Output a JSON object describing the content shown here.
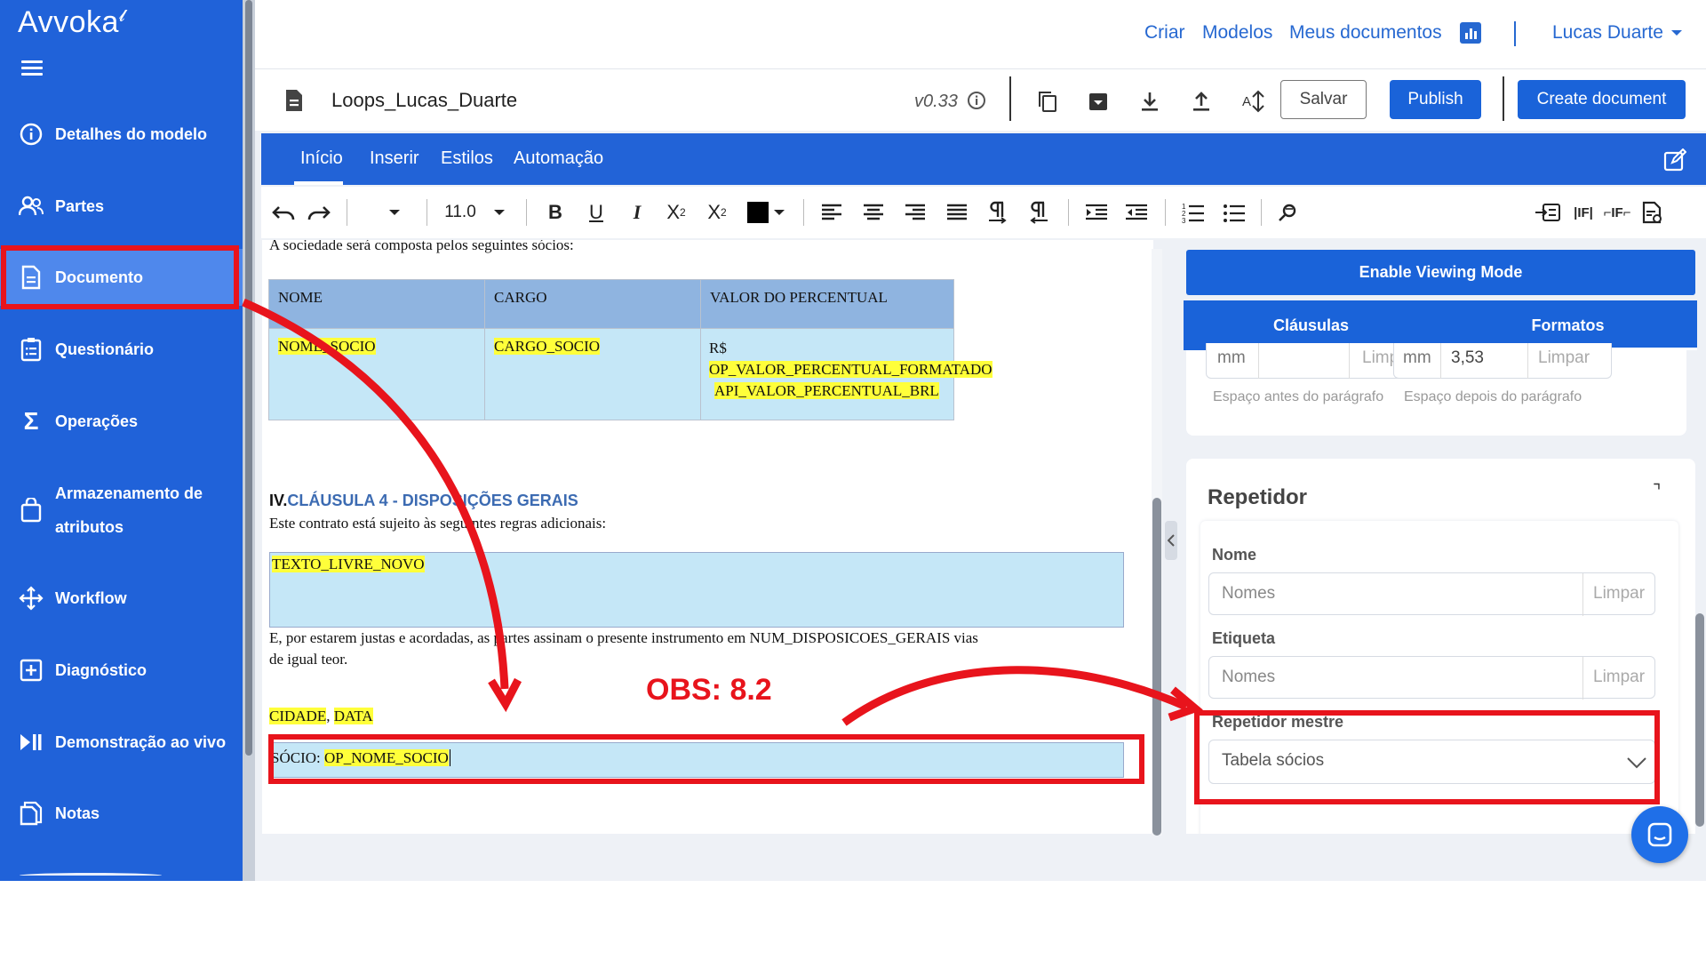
{
  "sidebar": {
    "brand": "Avvoka",
    "items": [
      {
        "label": "Detalhes do modelo",
        "icon": "info-icon"
      },
      {
        "label": "Partes",
        "icon": "users-icon"
      },
      {
        "label": "Documento",
        "icon": "document-icon"
      },
      {
        "label": "Questionário",
        "icon": "clipboard-icon"
      },
      {
        "label": "Operações",
        "icon": "sigma-icon"
      },
      {
        "label": "Armazenamento de",
        "label2": "atributos",
        "icon": "bag-icon"
      },
      {
        "label": "Workflow",
        "icon": "workflow-icon"
      },
      {
        "label": "Diagnóstico",
        "icon": "plus-box-icon"
      },
      {
        "label": "Demonstração ao vivo",
        "icon": "play-pause-icon"
      },
      {
        "label": "Notas",
        "icon": "notes-icon"
      }
    ]
  },
  "topbar": {
    "criar": "Criar",
    "modelos": "Modelos",
    "meus": "Meus documentos",
    "user": "Lucas Duarte"
  },
  "docbar": {
    "title": "Loops_Lucas_Duarte",
    "version": "v0.33",
    "save": "Salvar",
    "publish": "Publish",
    "create": "Create document"
  },
  "ribbon": {
    "tabs": [
      "Início",
      "Inserir",
      "Estilos",
      "Automação"
    ]
  },
  "format": {
    "font_size": "11.0"
  },
  "doc": {
    "intro": "A sociedade será composta pelos seguintes sócios:",
    "headers": [
      "NOME",
      "CARGO",
      "VALOR DO PERCENTUAL"
    ],
    "cell1": "NOME_SOCIO",
    "cell2": "CARGO_SOCIO",
    "cell3a": "R$",
    "cell3b": "OP_VALOR_PERCENTUAL_FORMATADO",
    "cell3c": "API_VALOR_PERCENTUAL_BRL",
    "clause_num": "IV.",
    "clause_title": "CLÁUSULA 4 - DISPOSIÇÕES GERAIS",
    "clause_text": "Este contrato está sujeito às seguintes regras adicionais:",
    "free_text": "TEXTO_LIVRE_NOVO",
    "closing1": "E, por estarem justas e acordadas, as partes assinam o presente instrumento em NUM_DISPOSICOES_GERAIS vias",
    "closing2": "de igual teor.",
    "city": "CIDADE",
    "sep": ",",
    "date": "DATA",
    "socio_label": "SÓCIO:",
    "socio_var": "OP_NOME_SOCIO"
  },
  "annotation": {
    "obs": "OBS: 8.2"
  },
  "panel": {
    "viewing": "Enable Viewing Mode",
    "tab1": "Cláusulas",
    "tab2": "Formatos",
    "mm1": "mm",
    "limpar": "Limpar",
    "mm2": "mm",
    "spacing_val": "3,53",
    "before": "Espaço antes do parágrafo",
    "after": "Espaço depois do parágrafo",
    "section": "Repetidor",
    "nome_label": "Nome",
    "nome_ph": "Nomes",
    "etiqueta_label": "Etiqueta",
    "etiqueta_ph": "Nomes",
    "mestre_label": "Repetidor mestre",
    "mestre_value": "Tabela sócios"
  },
  "colors": {
    "sidebar": "#2062d9",
    "accent": "#2263d7",
    "highlight": "#ffff3a",
    "cell_bg": "#c5e7f7",
    "annotation_red": "#e8141c"
  }
}
